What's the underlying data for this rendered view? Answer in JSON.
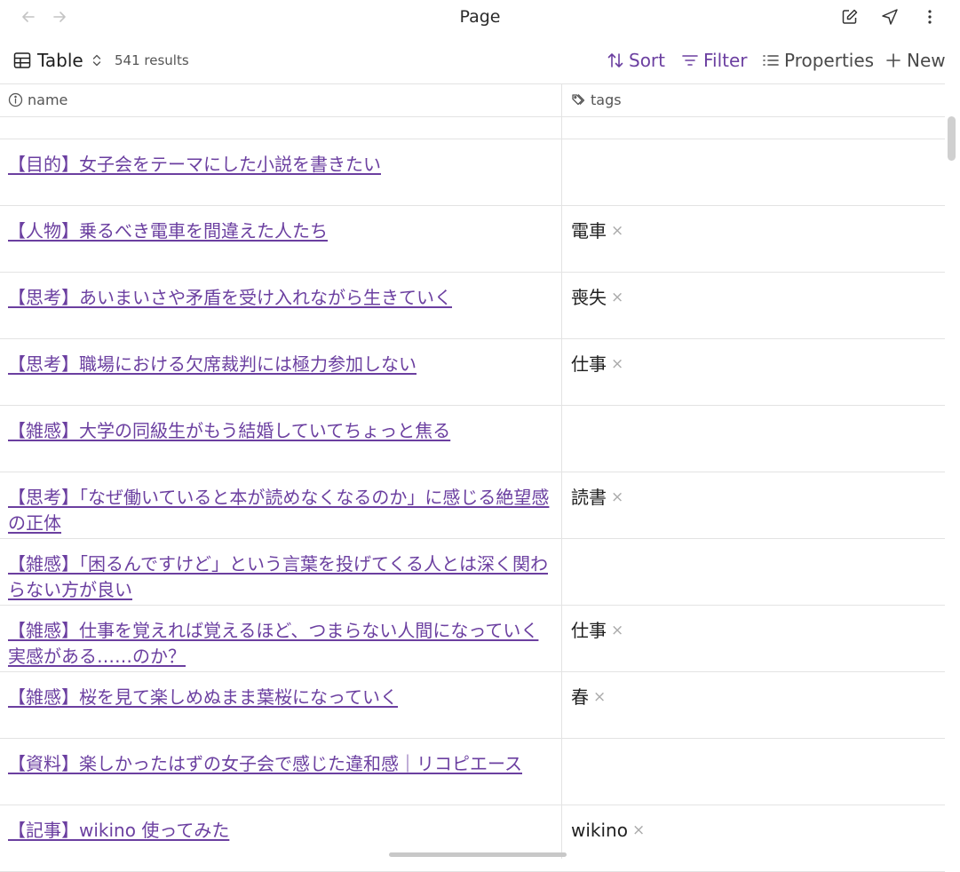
{
  "header": {
    "title": "Page"
  },
  "toolbar": {
    "view_label": "Table",
    "results": "541 results",
    "sort_label": "Sort",
    "filter_label": "Filter",
    "properties_label": "Properties",
    "new_label": "New"
  },
  "columns": {
    "name": "name",
    "tags": "tags"
  },
  "rows": [
    {
      "name": "【目的】女子会をテーマにした小説を書きたい",
      "tag": ""
    },
    {
      "name": "【人物】乗るべき電車を間違えた人たち",
      "tag": "電車"
    },
    {
      "name": "【思考】あいまいさや矛盾を受け入れながら生きていく",
      "tag": "喪失"
    },
    {
      "name": "【思考】職場における欠席裁判には極力参加しない",
      "tag": "仕事"
    },
    {
      "name": "【雑感】大学の同級生がもう結婚していてちょっと焦る",
      "tag": ""
    },
    {
      "name": "【思考】「なぜ働いていると本が読めなくなるのか」に感じる絶望感の正体",
      "tag": "読書"
    },
    {
      "name": "【雑感】「困るんですけど」という言葉を投げてくる人とは深く関わらない方が良い",
      "tag": ""
    },
    {
      "name": "【雑感】仕事を覚えれば覚えるほど、つまらない人間になっていく実感がある……のか？",
      "tag": "仕事"
    },
    {
      "name": "【雑感】桜を見て楽しめぬまま葉桜になっていく",
      "tag": "春"
    },
    {
      "name": "【資料】楽しかったはずの女子会で感じた違和感｜リコピエース",
      "tag": ""
    },
    {
      "name": "【記事】wikino 使ってみた",
      "tag": "wikino"
    }
  ],
  "tag_remove_glyph": "×",
  "colors": {
    "accent": "#6b3fa0",
    "border": "#e3e3e3"
  }
}
